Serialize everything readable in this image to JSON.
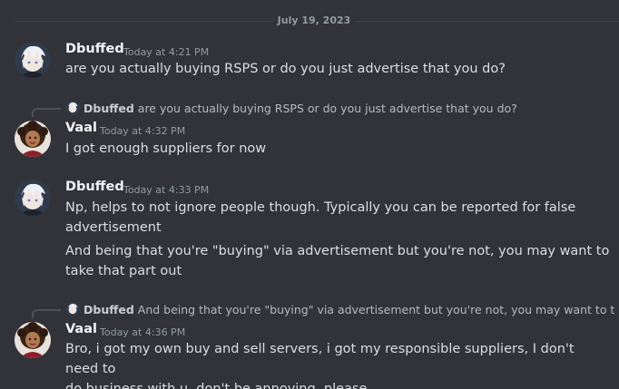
{
  "date_divider": "July 19, 2023",
  "messages": [
    {
      "author": "Dbuffed",
      "timestamp": "Today at 4:21 PM",
      "lines": [
        "are you actually buying RSPS or do you just advertise that you do?"
      ]
    },
    {
      "reply_to": {
        "author": "Dbuffed",
        "text": "are you actually buying RSPS or do you just advertise that you do?"
      },
      "author": "Vaal",
      "timestamp": "Today at 4:32 PM",
      "lines": [
        "I got enough suppliers for now"
      ]
    },
    {
      "author": "Dbuffed",
      "timestamp": "Today at 4:33 PM",
      "lines": [
        "Np, helps to not ignore people though. Typically you can be reported for false",
        "advertisement",
        "And being that you're \"buying\" via advertisement but you're not, you may want to",
        "take that part out"
      ]
    },
    {
      "reply_to": {
        "author": "Dbuffed",
        "text": "And being that you're \"buying\" via advertisement but you're not, you may want to take"
      },
      "author": "Vaal",
      "timestamp": "Today at 4:36 PM",
      "lines": [
        "Bro, i got my own buy and sell servers, i got my responsible suppliers, I don't need to",
        "do business with u, don't be annoying, please."
      ]
    }
  ],
  "colors": {
    "background": "#313338",
    "text": "#dbdee1",
    "muted": "#949ba4",
    "username": "#f2f3f5"
  },
  "icons": {
    "dbuffed_avatar": "white-haired-anime-avatar",
    "vaal_avatar": "curly-haired-character-avatar"
  }
}
